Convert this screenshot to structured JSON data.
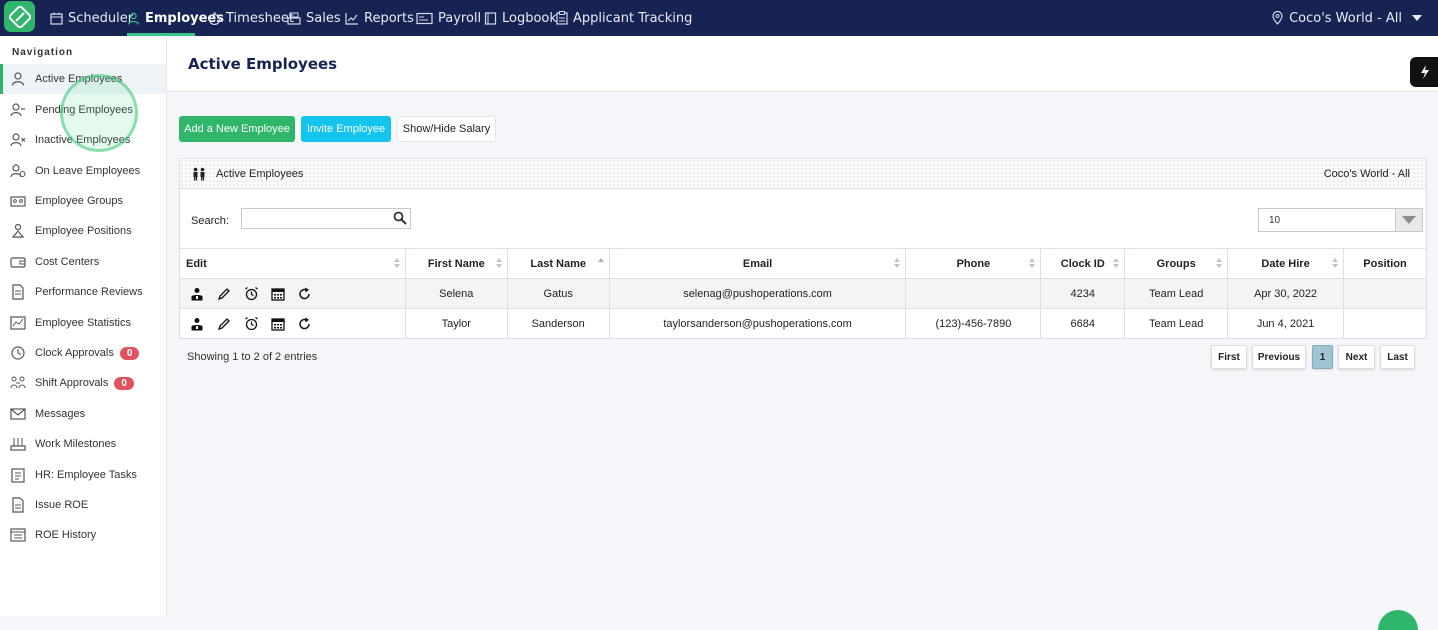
{
  "topnav": {
    "items": [
      {
        "label": "Scheduler",
        "icon": "calendar-icon"
      },
      {
        "label": "Employees",
        "icon": "person-icon"
      },
      {
        "label": "Timesheet",
        "icon": "stopwatch-icon"
      },
      {
        "label": "Sales",
        "icon": "register-icon"
      },
      {
        "label": "Reports",
        "icon": "trend-chart-icon"
      },
      {
        "label": "Payroll",
        "icon": "card-icon"
      },
      {
        "label": "Logbook",
        "icon": "book-icon"
      },
      {
        "label": "Applicant Tracking",
        "icon": "clipboard-icon"
      }
    ],
    "active": "Employees",
    "location": "Coco's World - All"
  },
  "sidebar": {
    "heading": "Navigation",
    "items": [
      {
        "label": "Active Employees",
        "icon": "person-icon"
      },
      {
        "label": "Pending Employees",
        "icon": "person-minus-icon"
      },
      {
        "label": "Inactive Employees",
        "icon": "person-x-icon"
      },
      {
        "label": "On Leave Employees",
        "icon": "person-leave-icon"
      },
      {
        "label": "Employee Groups",
        "icon": "group-icon"
      },
      {
        "label": "Employee Positions",
        "icon": "position-icon"
      },
      {
        "label": "Cost Centers",
        "icon": "wallet-icon"
      },
      {
        "label": "Performance Reviews",
        "icon": "document-icon"
      },
      {
        "label": "Employee Statistics",
        "icon": "statistics-icon"
      },
      {
        "label": "Clock Approvals",
        "icon": "clock-icon",
        "badge": "0"
      },
      {
        "label": "Shift Approvals",
        "icon": "shift-icon",
        "badge": "0"
      },
      {
        "label": "Messages",
        "icon": "envelope-icon"
      },
      {
        "label": "Work Milestones",
        "icon": "milestone-icon"
      },
      {
        "label": "HR: Employee Tasks",
        "icon": "tasks-icon"
      },
      {
        "label": "Issue ROE",
        "icon": "issue-icon"
      },
      {
        "label": "ROE History",
        "icon": "history-icon"
      }
    ],
    "active": "Active Employees"
  },
  "page": {
    "title": "Active Employees"
  },
  "actions": {
    "add": "Add a New Employee",
    "invite": "Invite Employee",
    "salary": "Show/Hide Salary"
  },
  "panel": {
    "title": "Active Employees",
    "location": "Coco's World - All",
    "search_label": "Search:",
    "search_value": "",
    "page_length": "10"
  },
  "table": {
    "columns": [
      "Edit",
      "First Name",
      "Last Name",
      "Email",
      "Phone",
      "Clock ID",
      "Groups",
      "Date Hire",
      "Position"
    ],
    "sorted_column": "Last Name",
    "rows": [
      {
        "first": "Selena",
        "last": "Gatus",
        "email": "selenag@pushoperations.com",
        "phone": "",
        "clock_id": "4234",
        "groups": "Team Lead",
        "date_hire": "Apr 30, 2022",
        "position": ""
      },
      {
        "first": "Taylor",
        "last": "Sanderson",
        "email": "taylorsanderson@pushoperations.com",
        "phone": "(123)-456-7890",
        "clock_id": "6684",
        "groups": "Team Lead",
        "date_hire": "Jun 4, 2021",
        "position": ""
      }
    ]
  },
  "footer": {
    "showing": "Showing 1 to 2 of 2 entries",
    "pager": {
      "first": "First",
      "previous": "Previous",
      "current": "1",
      "next": "Next",
      "last": "Last"
    }
  },
  "colors": {
    "nav_bg": "#172453",
    "accent_green": "#2fb66b",
    "accent_cyan": "#12c4ee",
    "badge_red": "#e05260"
  }
}
